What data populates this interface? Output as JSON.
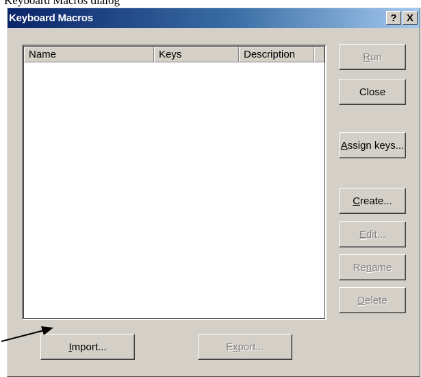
{
  "caption": "Keyboard Macros dialog",
  "window": {
    "title": "Keyboard Macros",
    "help_glyph": "?",
    "close_glyph": "X"
  },
  "list": {
    "columns": [
      "Name",
      "Keys",
      "Description"
    ],
    "rows": []
  },
  "buttons": {
    "run": {
      "pre": "",
      "mn": "R",
      "post": "un",
      "enabled": false
    },
    "close": {
      "pre": "Close",
      "mn": "",
      "post": "",
      "enabled": true
    },
    "assign_keys": {
      "pre": "",
      "mn": "A",
      "post": "ssign keys...",
      "enabled": true
    },
    "create": {
      "pre": "",
      "mn": "C",
      "post": "reate...",
      "enabled": true
    },
    "edit": {
      "pre": "",
      "mn": "E",
      "post": "dit...",
      "enabled": false
    },
    "rename": {
      "pre": "Re",
      "mn": "n",
      "post": "ame",
      "enabled": false
    },
    "delete": {
      "pre": "",
      "mn": "D",
      "post": "elete",
      "enabled": false
    },
    "import": {
      "pre": "",
      "mn": "I",
      "post": "mport...",
      "enabled": true
    },
    "export": {
      "pre": "E",
      "mn": "x",
      "post": "port...",
      "enabled": false
    }
  },
  "annotation": {
    "arrow_color": "#000000"
  },
  "colors": {
    "dialog_face": "#d4d0c8",
    "title_start": "#0a246a",
    "title_end": "#a6caf0"
  }
}
